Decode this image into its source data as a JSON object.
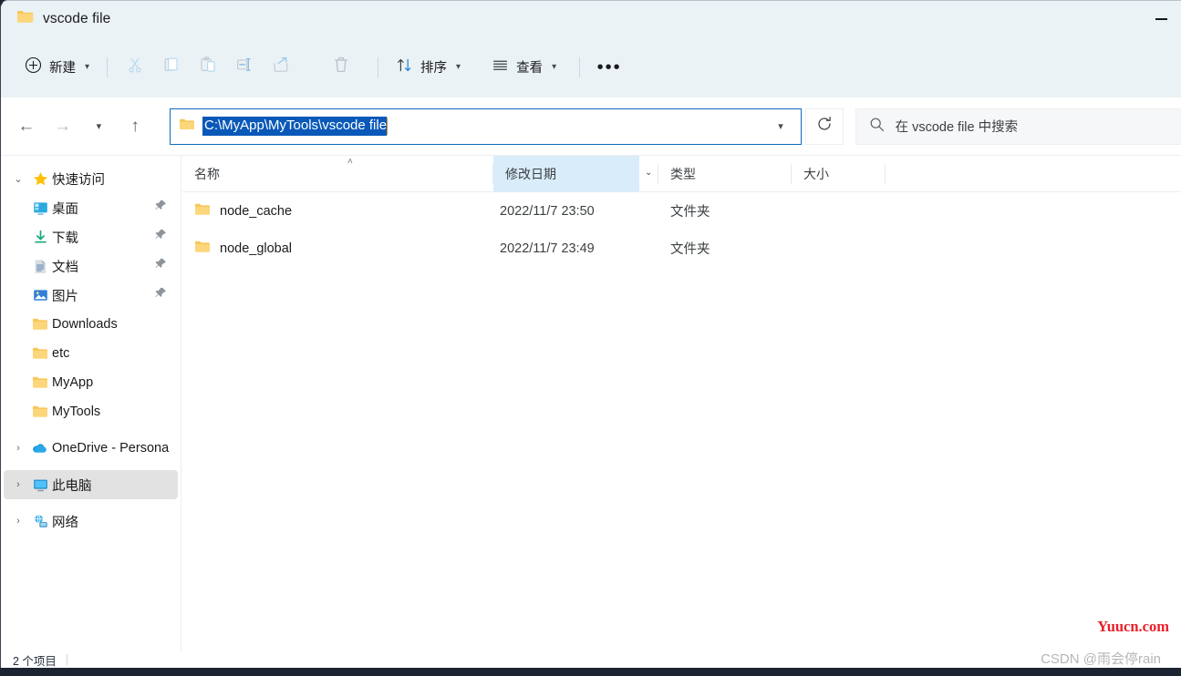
{
  "window": {
    "title": "vscode file",
    "minimize_label": "—"
  },
  "toolbar": {
    "new_label": "新建",
    "new_icon": "plus-circle-icon",
    "cut_icon": "scissors-icon",
    "copy_icon": "copy-icon",
    "paste_icon": "paste-icon",
    "rename_icon": "rename-icon",
    "share_icon": "share-icon",
    "delete_icon": "trash-icon",
    "sort_label": "排序",
    "sort_icon": "sort-arrows-icon",
    "view_label": "查看",
    "view_icon": "view-lines-icon",
    "more_label": "•••"
  },
  "nav": {
    "back_icon": "arrow-left-icon",
    "forward_icon": "arrow-right-icon",
    "recent_icon": "chevron-down-icon",
    "up_icon": "arrow-up-icon",
    "refresh_icon": "refresh-icon",
    "address": {
      "value": "C:\\MyApp\\MyTools\\vscode file",
      "folder_icon": "folder-icon",
      "dropdown_icon": "chevron-down-icon"
    },
    "search": {
      "placeholder": "在 vscode file 中搜索",
      "icon": "search-icon"
    }
  },
  "sidebar": {
    "items": [
      {
        "label": "快速访问",
        "icon": "star-icon",
        "twisty": "⌄",
        "level": 0,
        "pinned": false,
        "selected": false
      },
      {
        "label": "桌面",
        "icon": "desktop-icon",
        "twisty": "",
        "level": 1,
        "pinned": true,
        "selected": false
      },
      {
        "label": "下载",
        "icon": "download-icon",
        "twisty": "",
        "level": 1,
        "pinned": true,
        "selected": false
      },
      {
        "label": "文档",
        "icon": "document-icon",
        "twisty": "",
        "level": 1,
        "pinned": true,
        "selected": false
      },
      {
        "label": "图片",
        "icon": "pictures-icon",
        "twisty": "",
        "level": 1,
        "pinned": true,
        "selected": false
      },
      {
        "label": "Downloads",
        "icon": "folder-icon",
        "twisty": "",
        "level": 1,
        "pinned": false,
        "selected": false
      },
      {
        "label": "etc",
        "icon": "folder-icon",
        "twisty": "",
        "level": 1,
        "pinned": false,
        "selected": false
      },
      {
        "label": "MyApp",
        "icon": "folder-icon",
        "twisty": "",
        "level": 1,
        "pinned": false,
        "selected": false
      },
      {
        "label": "MyTools",
        "icon": "folder-icon",
        "twisty": "",
        "level": 1,
        "pinned": false,
        "selected": false
      },
      {
        "label": "OneDrive - Persona",
        "icon": "onedrive-cloud-icon",
        "twisty": "›",
        "level": 0,
        "pinned": false,
        "selected": false
      },
      {
        "label": "此电脑",
        "icon": "this-pc-icon",
        "twisty": "›",
        "level": 0,
        "pinned": false,
        "selected": true
      },
      {
        "label": "网络",
        "icon": "network-icon",
        "twisty": "›",
        "level": 0,
        "pinned": false,
        "selected": false
      }
    ]
  },
  "filelist": {
    "columns": [
      {
        "label": "名称",
        "hot": false
      },
      {
        "label": "修改日期",
        "hot": true
      },
      {
        "label": "类型",
        "hot": false
      },
      {
        "label": "大小",
        "hot": false
      }
    ],
    "sort_caret": "˄",
    "col_chevron": "⌄",
    "rows": [
      {
        "name": "node_cache",
        "date": "2022/11/7 23:50",
        "type": "文件夹",
        "size": "",
        "icon": "folder-icon"
      },
      {
        "name": "node_global",
        "date": "2022/11/7 23:49",
        "type": "文件夹",
        "size": "",
        "icon": "folder-icon"
      }
    ]
  },
  "statusbar": {
    "item_count": "2 个项目"
  },
  "watermarks": {
    "yuucn": "Yuucn.com",
    "csdn": "CSDN @雨会停rain"
  },
  "colors": {
    "chrome": "#eaf2f5",
    "accent": "#0f6cbd",
    "selection": "#0a59b8",
    "col_hot": "#d9ecfa",
    "nav_selected": "#e2e2e2",
    "watermark_red": "#e8202a",
    "watermark_gray": "#b6b6b6"
  }
}
